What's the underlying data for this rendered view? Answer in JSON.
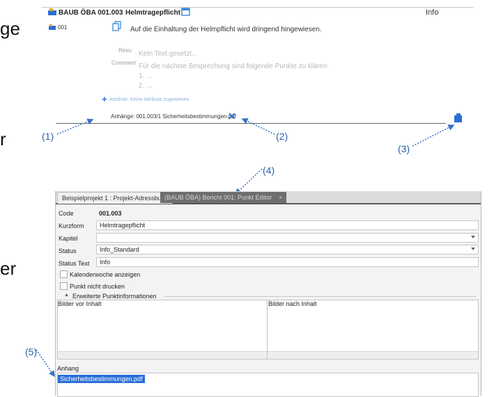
{
  "left_fragments": [
    "ge",
    "r",
    "er"
  ],
  "point_row": {
    "project_code": "BAUB ÖBA 001.003",
    "title": "Helmtragepflicht",
    "status": "Info",
    "number": "001",
    "content": "Auf die Einhaltung der Helmpflicht wird dringend hingewiesen.",
    "result_label": "Resu",
    "result_placeholder": "Kein Text gesetzt...",
    "comment_label": "Comment",
    "comment_lines": [
      "Für die nächste Besprechung sind folgende Punkte zu klären:",
      "1. ...",
      "2. ..."
    ],
    "attributes_text": "Attribute: Keine Attribute zugewiesen",
    "attachment_text": "Anhänge: 001.003/1 Sicherheitsbestimmungen.pdf"
  },
  "callouts": [
    "(1)",
    "(2)",
    "(3)",
    "(4)",
    "(5)"
  ],
  "editor": {
    "tabs": [
      {
        "label": "Beispielprojekt 1 : Projekt-Adressbuch"
      },
      {
        "label": "(BAUB ÖBA) Bericht 001: Punkt Editor",
        "close": "×"
      }
    ],
    "fields": {
      "code_label": "Code",
      "code_value": "001.003",
      "kurzform_label": "Kurzform",
      "kurzform_value": "Helmtragepflicht",
      "kapitel_label": "Kapitel",
      "kapitel_value": "",
      "status_label": "Status",
      "status_value": "Info_Standard",
      "status_text_label": "Status Text",
      "status_text_value": "Info"
    },
    "checkboxes": [
      "Kalenderwoche anzeigen",
      "Punkt nicht drucken"
    ],
    "group_title": "Erweiterte Punktinformationen",
    "grid_headers": [
      "Bilder vor Inhalt",
      "Bilder nach Inhalt"
    ],
    "anhang_label": "Anhang",
    "anhang_item": "Sicherheitsbestimmungen.pdf"
  },
  "colors": {
    "accent": "#2a6fd6",
    "callout": "#2b5fb0",
    "tab_active": "#6e6e6e"
  }
}
